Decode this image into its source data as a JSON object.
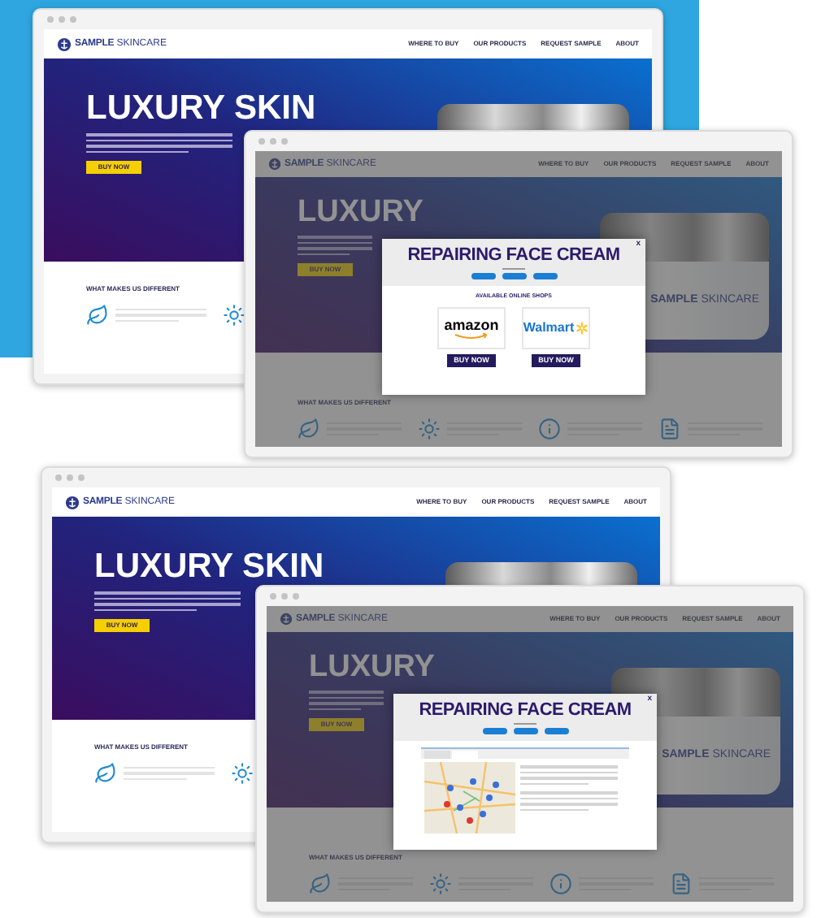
{
  "mockups": [
    {
      "back": {
        "logo_bold": "SAMPLE",
        "logo_light": "SKINCARE",
        "nav": [
          "WHERE TO BUY",
          "OUR PRODUCTS",
          "REQUEST SAMPLE",
          "ABOUT"
        ],
        "hero_title": "LUXURY SKIN",
        "hero_button": "BUY NOW",
        "section_title": "WHAT MAKES US DIFFERENT"
      },
      "front": {
        "logo_bold": "SAMPLE",
        "logo_light": "SKINCARE",
        "nav": [
          "WHERE TO BUY",
          "OUR PRODUCTS",
          "REQUEST SAMPLE",
          "ABOUT"
        ],
        "hero_title": "LUXURY",
        "hero_button": "BUY NOW",
        "section_title": "WHAT MAKES US DIFFERENT",
        "jar_label_bold": "SAMPLE",
        "jar_label_light": "SKINCARE",
        "popup": {
          "kind": "shops",
          "close": "x",
          "title": "REPAIRING FACE CREAM",
          "shops_heading": "AVAILABLE ONLINE SHOPS",
          "shops": [
            {
              "kind": "amazon",
              "name": "amazon",
              "button": "BUY NOW"
            },
            {
              "kind": "walmart",
              "name": "Walmart",
              "button": "BUY NOW"
            }
          ]
        }
      }
    },
    {
      "back": {
        "logo_bold": "SAMPLE",
        "logo_light": "SKINCARE",
        "nav": [
          "WHERE TO BUY",
          "OUR PRODUCTS",
          "REQUEST SAMPLE",
          "ABOUT"
        ],
        "hero_title": "LUXURY SKIN",
        "hero_button": "BUY NOW",
        "section_title": "WHAT MAKES US DIFFERENT"
      },
      "front": {
        "logo_bold": "SAMPLE",
        "logo_light": "SKINCARE",
        "nav": [
          "WHERE TO BUY",
          "OUR PRODUCTS",
          "REQUEST SAMPLE",
          "ABOUT"
        ],
        "hero_title": "LUXURY",
        "hero_button": "BUY NOW",
        "section_title": "WHAT MAKES US DIFFERENT",
        "jar_label_bold": "SAMPLE",
        "jar_label_light": "SKINCARE",
        "popup": {
          "kind": "map",
          "close": "x",
          "title": "REPAIRING FACE CREAM"
        }
      }
    }
  ]
}
